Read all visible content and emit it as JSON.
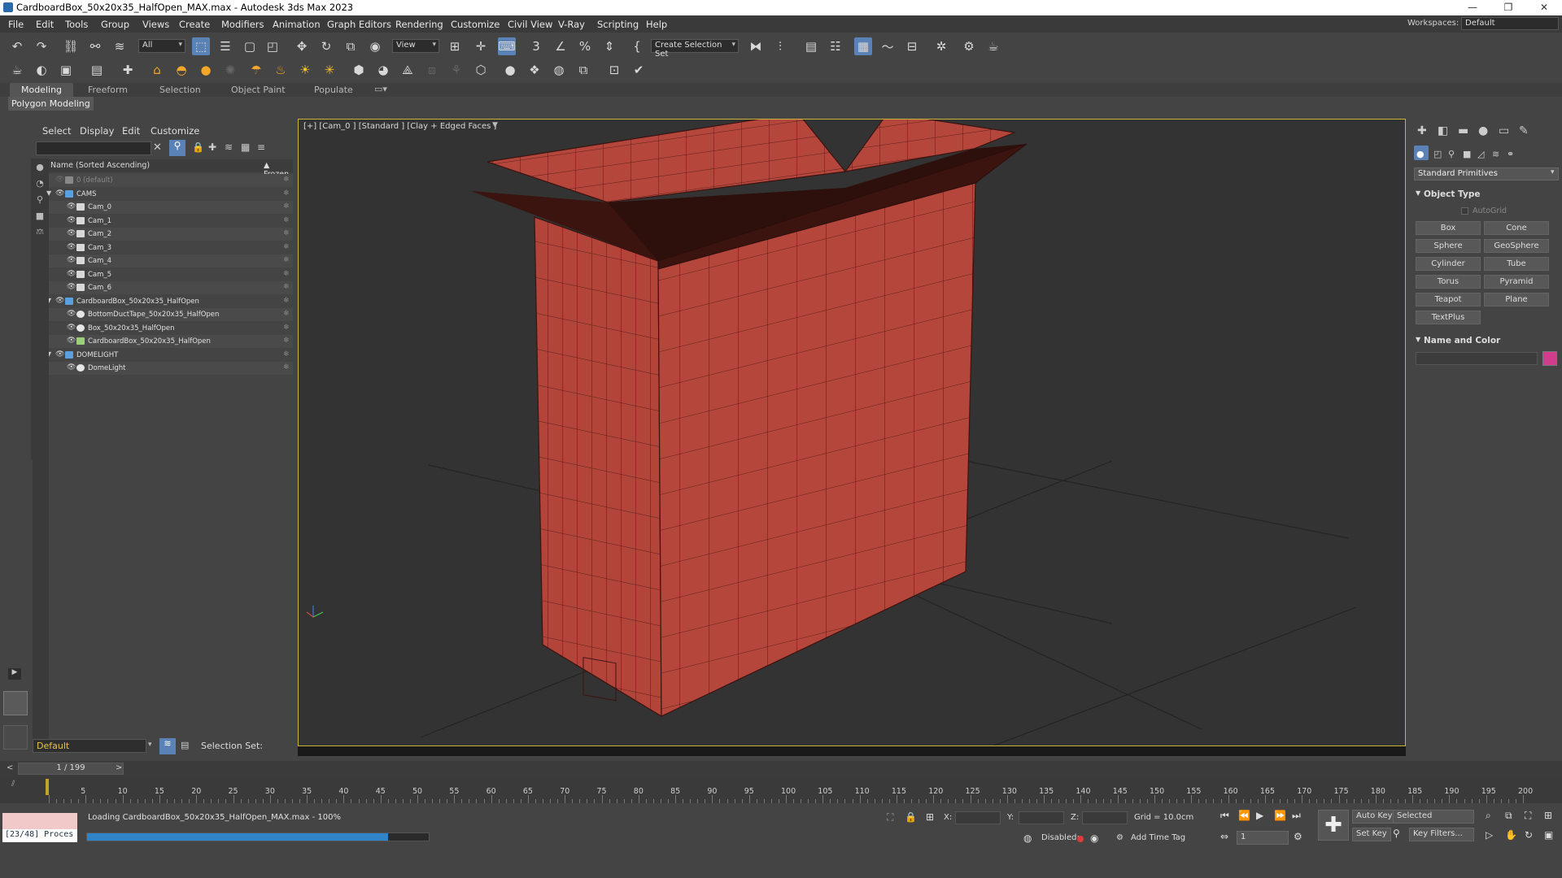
{
  "window": {
    "title": "CardboardBox_50x20x35_HalfOpen_MAX.max - Autodesk 3ds Max 2023",
    "minimize": "—",
    "maximize": "❐",
    "close": "✕"
  },
  "menubar": {
    "items": [
      "File",
      "Edit",
      "Tools",
      "Group",
      "Views",
      "Create",
      "Modifiers",
      "Animation",
      "Graph Editors",
      "Rendering",
      "Customize",
      "Civil View",
      "V-Ray",
      "Scripting",
      "Help"
    ],
    "workspaces_label": "Workspaces:",
    "workspaces_value": "Default"
  },
  "toolbar": {
    "selection_filter": "All",
    "ref_coord": "View",
    "named_selection": "Create Selection Set"
  },
  "ribbon": {
    "tabs": [
      "Modeling",
      "Freeform",
      "Selection",
      "Object Paint",
      "Populate"
    ],
    "subpanel": "Polygon Modeling"
  },
  "explorer": {
    "menu": [
      "Select",
      "Display",
      "Edit",
      "Customize"
    ],
    "header_name": "Name (Sorted Ascending)",
    "header_frozen": "▲ Frozen",
    "rows": [
      {
        "label": "0 (default)",
        "indent": 0,
        "type": "layer-default"
      },
      {
        "label": "CAMS",
        "indent": 0,
        "type": "layer"
      },
      {
        "label": "Cam_0",
        "indent": 1,
        "type": "camera"
      },
      {
        "label": "Cam_1",
        "indent": 1,
        "type": "camera"
      },
      {
        "label": "Cam_2",
        "indent": 1,
        "type": "camera"
      },
      {
        "label": "Cam_3",
        "indent": 1,
        "type": "camera"
      },
      {
        "label": "Cam_4",
        "indent": 1,
        "type": "camera"
      },
      {
        "label": "Cam_5",
        "indent": 1,
        "type": "camera"
      },
      {
        "label": "Cam_6",
        "indent": 1,
        "type": "camera"
      },
      {
        "label": "CardboardBox_50x20x35_HalfOpen",
        "indent": 0,
        "type": "layer"
      },
      {
        "label": "BottomDuctTape_50x20x35_HalfOpen",
        "indent": 1,
        "type": "mesh"
      },
      {
        "label": "Box_50x20x35_HalfOpen",
        "indent": 1,
        "type": "mesh"
      },
      {
        "label": "CardboardBox_50x20x35_HalfOpen",
        "indent": 1,
        "type": "group"
      },
      {
        "label": "DOMELIGHT",
        "indent": 0,
        "type": "layer"
      },
      {
        "label": "DomeLight",
        "indent": 1,
        "type": "light"
      }
    ],
    "layer_value": "Default",
    "selection_set_label": "Selection Set:"
  },
  "viewport": {
    "label": "[+] [Cam_0 ] [Standard ] [Clay + Edged Faces ]",
    "box_color": "#b5443a",
    "box_dark": "#7c2a22",
    "inner_color": "#2d0f0c",
    "grid_color": "#222222"
  },
  "command_panel": {
    "category": "Standard Primitives",
    "rollout_object_type": "Object Type",
    "autogrid": "AutoGrid",
    "buttons": [
      "Box",
      "Cone",
      "Sphere",
      "GeoSphere",
      "Cylinder",
      "Tube",
      "Torus",
      "Pyramid",
      "Teapot",
      "Plane",
      "TextPlus"
    ],
    "rollout_name_color": "Name and Color",
    "object_color": "#d23c8c"
  },
  "timeline": {
    "frame_display": "1 / 199",
    "ticks": [
      5,
      10,
      15,
      20,
      25,
      30,
      35,
      40,
      45,
      50,
      55,
      60,
      65,
      70,
      75,
      80,
      85,
      90,
      95,
      100,
      105,
      110,
      115,
      120,
      125,
      130,
      135,
      140,
      145,
      150,
      155,
      160,
      165,
      170,
      175,
      180,
      185,
      190,
      195,
      200
    ]
  },
  "status": {
    "script_line": "[23/48] Proces",
    "loading_text": "Loading CardboardBox_50x20x35_HalfOpen_MAX.max  -  100%",
    "progress": 0.88,
    "x_label": "X:",
    "y_label": "Y:",
    "z_label": "Z:",
    "grid": "Grid = 10.0cm",
    "disabled_label": "Disabled:",
    "add_time_tag": "Add Time Tag",
    "auto_key": "Auto Key",
    "set_key": "Set Key",
    "key_mode": "Selected",
    "key_filters": "Key Filters...",
    "frame_spinner": "1"
  }
}
